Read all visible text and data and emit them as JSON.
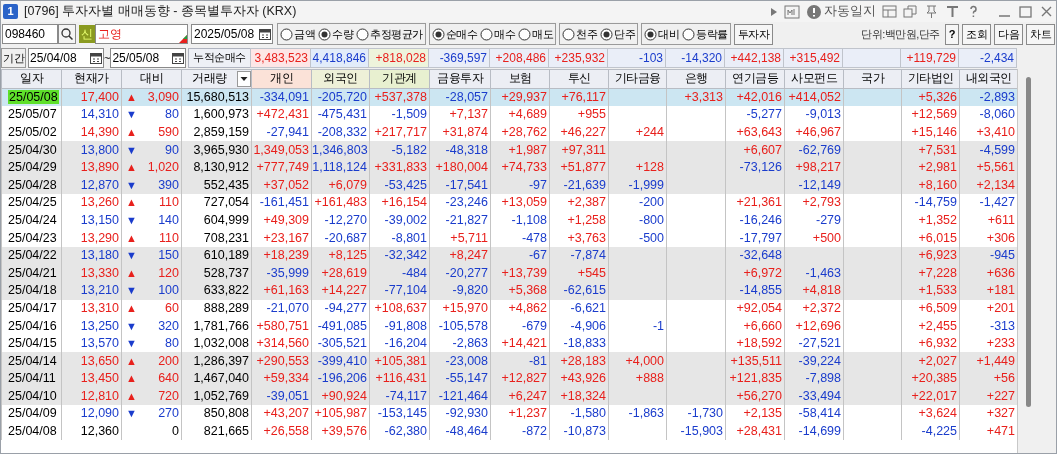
{
  "window": {
    "number": "1",
    "title": "[0796] 투자자별 매매동향 - 종목별투자자 (KRX)",
    "auto_log": "자동일지"
  },
  "toolbar": {
    "code": "098460",
    "new_badge": "신",
    "name": "고영",
    "date": "2025/05/08",
    "option_groups": [
      [
        {
          "label": "금액",
          "selected": false
        },
        {
          "label": "수량",
          "selected": true
        },
        {
          "label": "추정평균가",
          "selected": false
        }
      ],
      [
        {
          "label": "순매수",
          "selected": true
        },
        {
          "label": "매수",
          "selected": false
        },
        {
          "label": "매도",
          "selected": false
        }
      ],
      [
        {
          "label": "천주",
          "selected": false
        },
        {
          "label": "단주",
          "selected": true
        }
      ],
      [
        {
          "label": "대비",
          "selected": true
        },
        {
          "label": "등락률",
          "selected": false
        }
      ]
    ],
    "investor_button": "투자자",
    "unit": "단위:백만원,단주",
    "buttons": [
      "?",
      "조회",
      "다음",
      "차트"
    ]
  },
  "period": {
    "label": "기간",
    "start": "25/04/08",
    "separator": "~",
    "end": "25/05/08",
    "total_label": "누적순매수",
    "totals": {
      "individual": {
        "value": "3,483,523",
        "up": true
      },
      "foreign": {
        "value": "4,418,846",
        "up": false
      },
      "institutions": {
        "value": "+818,028",
        "up": true
      },
      "financial_investment": {
        "value": "-369,597",
        "up": false
      },
      "insurance": {
        "value": "+208,486",
        "up": true
      },
      "investment_trust": {
        "value": "+235,932",
        "up": true
      },
      "other_finance": {
        "value": "-103",
        "up": false
      },
      "bank": {
        "value": "-14,320",
        "up": false
      },
      "pension_funds": {
        "value": "+442,138",
        "up": true
      },
      "private_equity": {
        "value": "+315,492",
        "up": true
      },
      "other_corporations": {
        "value": "+119,729",
        "up": true
      },
      "domestic_foreign": {
        "value": "-2,434",
        "up": false
      }
    }
  },
  "table": {
    "columns": [
      "일자",
      "현재가",
      "대비",
      "거래량",
      "개인",
      "외국인",
      "기관계",
      "금융투자",
      "보험",
      "투신",
      "기타금융",
      "은행",
      "연기금등",
      "사모펀드",
      "국가",
      "기타법인",
      "내외국인"
    ],
    "rows": [
      {
        "date": "25/05/08",
        "selected": true,
        "price": "17,400",
        "rising": true,
        "arrow": "▲",
        "change": "3,090",
        "volume": "15,680,513",
        "investors": {
          "individual": {
            "value": "-334,091",
            "up": false
          },
          "foreign": {
            "value": "-205,720",
            "up": false
          },
          "institutions": {
            "value": "+537,378",
            "up": true
          },
          "financial_investment": {
            "value": "-28,057",
            "up": false
          },
          "insurance": {
            "value": "+29,937",
            "up": true
          },
          "investment_trust": {
            "value": "+76,117",
            "up": true
          },
          "bank": {
            "value": "+3,313",
            "up": true
          },
          "pension_funds": {
            "value": "+42,016",
            "up": true
          },
          "private_equity": {
            "value": "+414,052",
            "up": true
          },
          "other_corporations": {
            "value": "+5,326",
            "up": true
          },
          "domestic_foreign": {
            "value": "-2,893",
            "up": false
          }
        }
      },
      {
        "date": "25/05/07",
        "selected": false,
        "price": "14,310",
        "rising": false,
        "arrow": "▼",
        "change": "80",
        "volume": "1,600,973",
        "investors": {
          "individual": {
            "value": "+472,431",
            "up": true
          },
          "foreign": {
            "value": "-475,431",
            "up": false
          },
          "institutions": {
            "value": "-1,509",
            "up": false
          },
          "financial_investment": {
            "value": "+7,137",
            "up": true
          },
          "insurance": {
            "value": "+4,689",
            "up": true
          },
          "investment_trust": {
            "value": "+955",
            "up": true
          },
          "pension_funds": {
            "value": "-5,277",
            "up": false
          },
          "private_equity": {
            "value": "-9,013",
            "up": false
          },
          "other_corporations": {
            "value": "+12,569",
            "up": true
          },
          "domestic_foreign": {
            "value": "-8,060",
            "up": false
          }
        }
      },
      {
        "date": "25/05/02",
        "selected": false,
        "price": "14,390",
        "rising": true,
        "arrow": "▲",
        "change": "590",
        "volume": "2,859,159",
        "investors": {
          "individual": {
            "value": "-27,941",
            "up": false
          },
          "foreign": {
            "value": "-208,332",
            "up": false
          },
          "institutions": {
            "value": "+217,717",
            "up": true
          },
          "financial_investment": {
            "value": "+31,874",
            "up": true
          },
          "insurance": {
            "value": "+28,762",
            "up": true
          },
          "investment_trust": {
            "value": "+46,227",
            "up": true
          },
          "other_finance": {
            "value": "+244",
            "up": true
          },
          "pension_funds": {
            "value": "+63,643",
            "up": true
          },
          "private_equity": {
            "value": "+46,967",
            "up": true
          },
          "other_corporations": {
            "value": "+15,146",
            "up": true
          },
          "domestic_foreign": {
            "value": "+3,410",
            "up": true
          }
        }
      },
      {
        "date": "25/04/30",
        "selected": false,
        "price": "13,800",
        "rising": false,
        "arrow": "▼",
        "change": "90",
        "volume": "3,965,930",
        "investors": {
          "individual": {
            "value": "1,349,053",
            "up": true
          },
          "foreign": {
            "value": "1,346,803",
            "up": false
          },
          "institutions": {
            "value": "-5,182",
            "up": false
          },
          "financial_investment": {
            "value": "-48,318",
            "up": false
          },
          "insurance": {
            "value": "+1,987",
            "up": true
          },
          "investment_trust": {
            "value": "+97,311",
            "up": true
          },
          "pension_funds": {
            "value": "+6,607",
            "up": true
          },
          "private_equity": {
            "value": "-62,769",
            "up": false
          },
          "other_corporations": {
            "value": "+7,531",
            "up": true
          },
          "domestic_foreign": {
            "value": "-4,599",
            "up": false
          }
        }
      },
      {
        "date": "25/04/29",
        "selected": false,
        "price": "13,890",
        "rising": true,
        "arrow": "▲",
        "change": "1,020",
        "volume": "8,130,912",
        "investors": {
          "individual": {
            "value": "+777,749",
            "up": true
          },
          "foreign": {
            "value": "1,118,124",
            "up": false
          },
          "institutions": {
            "value": "+331,833",
            "up": true
          },
          "financial_investment": {
            "value": "+180,004",
            "up": true
          },
          "insurance": {
            "value": "+74,733",
            "up": true
          },
          "investment_trust": {
            "value": "+51,877",
            "up": true
          },
          "other_finance": {
            "value": "+128",
            "up": true
          },
          "pension_funds": {
            "value": "-73,126",
            "up": false
          },
          "private_equity": {
            "value": "+98,217",
            "up": true
          },
          "other_corporations": {
            "value": "+2,981",
            "up": true
          },
          "domestic_foreign": {
            "value": "+5,561",
            "up": true
          }
        }
      },
      {
        "date": "25/04/28",
        "selected": false,
        "price": "12,870",
        "rising": false,
        "arrow": "▼",
        "change": "390",
        "volume": "552,435",
        "investors": {
          "individual": {
            "value": "+37,052",
            "up": true
          },
          "foreign": {
            "value": "+6,079",
            "up": true
          },
          "institutions": {
            "value": "-53,425",
            "up": false
          },
          "financial_investment": {
            "value": "-17,541",
            "up": false
          },
          "insurance": {
            "value": "-97",
            "up": false
          },
          "investment_trust": {
            "value": "-21,639",
            "up": false
          },
          "other_finance": {
            "value": "-1,999",
            "up": false
          },
          "private_equity": {
            "value": "-12,149",
            "up": false
          },
          "other_corporations": {
            "value": "+8,160",
            "up": true
          },
          "domestic_foreign": {
            "value": "+2,134",
            "up": true
          }
        }
      },
      {
        "date": "25/04/25",
        "selected": false,
        "price": "13,260",
        "rising": true,
        "arrow": "▲",
        "change": "110",
        "volume": "727,054",
        "investors": {
          "individual": {
            "value": "-161,451",
            "up": false
          },
          "foreign": {
            "value": "+161,483",
            "up": true
          },
          "institutions": {
            "value": "+16,154",
            "up": true
          },
          "financial_investment": {
            "value": "-23,246",
            "up": false
          },
          "insurance": {
            "value": "+13,059",
            "up": true
          },
          "investment_trust": {
            "value": "+2,387",
            "up": true
          },
          "other_finance": {
            "value": "-200",
            "up": false
          },
          "pension_funds": {
            "value": "+21,361",
            "up": true
          },
          "private_equity": {
            "value": "+2,793",
            "up": true
          },
          "other_corporations": {
            "value": "-14,759",
            "up": false
          },
          "domestic_foreign": {
            "value": "-1,427",
            "up": false
          }
        }
      },
      {
        "date": "25/04/24",
        "selected": false,
        "price": "13,150",
        "rising": false,
        "arrow": "▼",
        "change": "140",
        "volume": "604,999",
        "investors": {
          "individual": {
            "value": "+49,309",
            "up": true
          },
          "foreign": {
            "value": "-12,270",
            "up": false
          },
          "institutions": {
            "value": "-39,002",
            "up": false
          },
          "financial_investment": {
            "value": "-21,827",
            "up": false
          },
          "insurance": {
            "value": "-1,108",
            "up": false
          },
          "investment_trust": {
            "value": "+1,258",
            "up": true
          },
          "other_finance": {
            "value": "-800",
            "up": false
          },
          "pension_funds": {
            "value": "-16,246",
            "up": false
          },
          "private_equity": {
            "value": "-279",
            "up": false
          },
          "other_corporations": {
            "value": "+1,352",
            "up": true
          },
          "domestic_foreign": {
            "value": "+611",
            "up": true
          }
        }
      },
      {
        "date": "25/04/23",
        "selected": false,
        "price": "13,290",
        "rising": true,
        "arrow": "▲",
        "change": "110",
        "volume": "708,231",
        "investors": {
          "individual": {
            "value": "+23,167",
            "up": true
          },
          "foreign": {
            "value": "-20,687",
            "up": false
          },
          "institutions": {
            "value": "-8,801",
            "up": false
          },
          "financial_investment": {
            "value": "+5,711",
            "up": true
          },
          "insurance": {
            "value": "-478",
            "up": false
          },
          "investment_trust": {
            "value": "+3,763",
            "up": true
          },
          "other_finance": {
            "value": "-500",
            "up": false
          },
          "pension_funds": {
            "value": "-17,797",
            "up": false
          },
          "private_equity": {
            "value": "+500",
            "up": true
          },
          "other_corporations": {
            "value": "+6,015",
            "up": true
          },
          "domestic_foreign": {
            "value": "+306",
            "up": true
          }
        }
      },
      {
        "date": "25/04/22",
        "selected": false,
        "price": "13,180",
        "rising": false,
        "arrow": "▼",
        "change": "150",
        "volume": "610,189",
        "investors": {
          "individual": {
            "value": "+18,239",
            "up": true
          },
          "foreign": {
            "value": "+8,125",
            "up": true
          },
          "institutions": {
            "value": "-32,342",
            "up": false
          },
          "financial_investment": {
            "value": "+8,247",
            "up": true
          },
          "insurance": {
            "value": "-67",
            "up": false
          },
          "investment_trust": {
            "value": "-7,874",
            "up": false
          },
          "pension_funds": {
            "value": "-32,648",
            "up": false
          },
          "other_corporations": {
            "value": "+6,923",
            "up": true
          },
          "domestic_foreign": {
            "value": "-945",
            "up": false
          }
        }
      },
      {
        "date": "25/04/21",
        "selected": false,
        "price": "13,330",
        "rising": true,
        "arrow": "▲",
        "change": "120",
        "volume": "528,737",
        "investors": {
          "individual": {
            "value": "-35,999",
            "up": false
          },
          "foreign": {
            "value": "+28,619",
            "up": true
          },
          "institutions": {
            "value": "-484",
            "up": false
          },
          "financial_investment": {
            "value": "-20,277",
            "up": false
          },
          "insurance": {
            "value": "+13,739",
            "up": true
          },
          "investment_trust": {
            "value": "+545",
            "up": true
          },
          "pension_funds": {
            "value": "+6,972",
            "up": true
          },
          "private_equity": {
            "value": "-1,463",
            "up": false
          },
          "other_corporations": {
            "value": "+7,228",
            "up": true
          },
          "domestic_foreign": {
            "value": "+636",
            "up": true
          }
        }
      },
      {
        "date": "25/04/18",
        "selected": false,
        "price": "13,210",
        "rising": false,
        "arrow": "▼",
        "change": "100",
        "volume": "633,822",
        "investors": {
          "individual": {
            "value": "+61,163",
            "up": true
          },
          "foreign": {
            "value": "+14,227",
            "up": true
          },
          "institutions": {
            "value": "-77,104",
            "up": false
          },
          "financial_investment": {
            "value": "-9,820",
            "up": false
          },
          "insurance": {
            "value": "+5,368",
            "up": true
          },
          "investment_trust": {
            "value": "-62,615",
            "up": false
          },
          "pension_funds": {
            "value": "-14,855",
            "up": false
          },
          "private_equity": {
            "value": "+4,818",
            "up": true
          },
          "other_corporations": {
            "value": "+1,533",
            "up": true
          },
          "domestic_foreign": {
            "value": "+181",
            "up": true
          }
        }
      },
      {
        "date": "25/04/17",
        "selected": false,
        "price": "13,310",
        "rising": true,
        "arrow": "▲",
        "change": "60",
        "volume": "888,289",
        "investors": {
          "individual": {
            "value": "-21,070",
            "up": false
          },
          "foreign": {
            "value": "-94,277",
            "up": false
          },
          "institutions": {
            "value": "+108,637",
            "up": true
          },
          "financial_investment": {
            "value": "+15,970",
            "up": true
          },
          "insurance": {
            "value": "+4,862",
            "up": true
          },
          "investment_trust": {
            "value": "-6,621",
            "up": false
          },
          "pension_funds": {
            "value": "+92,054",
            "up": true
          },
          "private_equity": {
            "value": "+2,372",
            "up": true
          },
          "other_corporations": {
            "value": "+6,509",
            "up": true
          },
          "domestic_foreign": {
            "value": "+201",
            "up": true
          }
        }
      },
      {
        "date": "25/04/16",
        "selected": false,
        "price": "13,250",
        "rising": false,
        "arrow": "▼",
        "change": "320",
        "volume": "1,781,766",
        "investors": {
          "individual": {
            "value": "+580,751",
            "up": true
          },
          "foreign": {
            "value": "-491,085",
            "up": false
          },
          "institutions": {
            "value": "-91,808",
            "up": false
          },
          "financial_investment": {
            "value": "-105,578",
            "up": false
          },
          "insurance": {
            "value": "-679",
            "up": false
          },
          "investment_trust": {
            "value": "-4,906",
            "up": false
          },
          "other_finance": {
            "value": "-1",
            "up": false
          },
          "pension_funds": {
            "value": "+6,660",
            "up": true
          },
          "private_equity": {
            "value": "+12,696",
            "up": true
          },
          "other_corporations": {
            "value": "+2,455",
            "up": true
          },
          "domestic_foreign": {
            "value": "-313",
            "up": false
          }
        }
      },
      {
        "date": "25/04/15",
        "selected": false,
        "price": "13,570",
        "rising": false,
        "arrow": "▼",
        "change": "80",
        "volume": "1,032,008",
        "investors": {
          "individual": {
            "value": "+314,560",
            "up": true
          },
          "foreign": {
            "value": "-305,521",
            "up": false
          },
          "institutions": {
            "value": "-16,204",
            "up": false
          },
          "financial_investment": {
            "value": "-2,863",
            "up": false
          },
          "insurance": {
            "value": "+14,421",
            "up": true
          },
          "investment_trust": {
            "value": "-18,833",
            "up": false
          },
          "pension_funds": {
            "value": "+18,592",
            "up": true
          },
          "private_equity": {
            "value": "-27,521",
            "up": false
          },
          "other_corporations": {
            "value": "+6,932",
            "up": true
          },
          "domestic_foreign": {
            "value": "+233",
            "up": true
          }
        }
      },
      {
        "date": "25/04/14",
        "selected": false,
        "price": "13,650",
        "rising": true,
        "arrow": "▲",
        "change": "200",
        "volume": "1,286,397",
        "investors": {
          "individual": {
            "value": "+290,553",
            "up": true
          },
          "foreign": {
            "value": "-399,410",
            "up": false
          },
          "institutions": {
            "value": "+105,381",
            "up": true
          },
          "financial_investment": {
            "value": "-23,008",
            "up": false
          },
          "insurance": {
            "value": "-81",
            "up": false
          },
          "investment_trust": {
            "value": "+28,183",
            "up": true
          },
          "other_finance": {
            "value": "+4,000",
            "up": true
          },
          "pension_funds": {
            "value": "+135,511",
            "up": true
          },
          "private_equity": {
            "value": "-39,224",
            "up": false
          },
          "other_corporations": {
            "value": "+2,027",
            "up": true
          },
          "domestic_foreign": {
            "value": "+1,449",
            "up": true
          }
        }
      },
      {
        "date": "25/04/11",
        "selected": false,
        "price": "13,450",
        "rising": true,
        "arrow": "▲",
        "change": "640",
        "volume": "1,467,040",
        "investors": {
          "individual": {
            "value": "+59,334",
            "up": true
          },
          "foreign": {
            "value": "-196,206",
            "up": false
          },
          "institutions": {
            "value": "+116,431",
            "up": true
          },
          "financial_investment": {
            "value": "-55,147",
            "up": false
          },
          "insurance": {
            "value": "+12,827",
            "up": true
          },
          "investment_trust": {
            "value": "+43,926",
            "up": true
          },
          "other_finance": {
            "value": "+888",
            "up": true
          },
          "pension_funds": {
            "value": "+121,835",
            "up": true
          },
          "private_equity": {
            "value": "-7,898",
            "up": false
          },
          "other_corporations": {
            "value": "+20,385",
            "up": true
          },
          "domestic_foreign": {
            "value": "+56",
            "up": true
          }
        }
      },
      {
        "date": "25/04/10",
        "selected": false,
        "price": "12,810",
        "rising": true,
        "arrow": "▲",
        "change": "720",
        "volume": "1,052,769",
        "investors": {
          "individual": {
            "value": "-39,051",
            "up": false
          },
          "foreign": {
            "value": "+90,924",
            "up": true
          },
          "institutions": {
            "value": "-74,117",
            "up": false
          },
          "financial_investment": {
            "value": "-121,464",
            "up": false
          },
          "insurance": {
            "value": "+6,247",
            "up": true
          },
          "investment_trust": {
            "value": "+18,324",
            "up": true
          },
          "pension_funds": {
            "value": "+56,270",
            "up": true
          },
          "private_equity": {
            "value": "-33,494",
            "up": false
          },
          "other_corporations": {
            "value": "+22,017",
            "up": true
          },
          "domestic_foreign": {
            "value": "+227",
            "up": true
          }
        }
      },
      {
        "date": "25/04/09",
        "selected": false,
        "price": "12,090",
        "rising": false,
        "arrow": "▼",
        "change": "270",
        "volume": "850,808",
        "investors": {
          "individual": {
            "value": "+43,207",
            "up": true
          },
          "foreign": {
            "value": "+105,987",
            "up": true
          },
          "institutions": {
            "value": "-153,145",
            "up": false
          },
          "financial_investment": {
            "value": "-92,930",
            "up": false
          },
          "insurance": {
            "value": "+1,237",
            "up": true
          },
          "investment_trust": {
            "value": "-1,580",
            "up": false
          },
          "other_finance": {
            "value": "-1,863",
            "up": false
          },
          "bank": {
            "value": "-1,730",
            "up": false
          },
          "pension_funds": {
            "value": "+2,135",
            "up": true
          },
          "private_equity": {
            "value": "-58,414",
            "up": false
          },
          "other_corporations": {
            "value": "+3,624",
            "up": true
          },
          "domestic_foreign": {
            "value": "+327",
            "up": true
          }
        }
      },
      {
        "date": "25/04/08",
        "selected": false,
        "price": "12,360",
        "change": "0",
        "volume": "821,665",
        "investors": {
          "individual": {
            "value": "+26,558",
            "up": true
          },
          "foreign": {
            "value": "+39,576",
            "up": true
          },
          "institutions": {
            "value": "-62,380",
            "up": false
          },
          "financial_investment": {
            "value": "-48,464",
            "up": false
          },
          "insurance": {
            "value": "-872",
            "up": false
          },
          "investment_trust": {
            "value": "-10,873",
            "up": false
          },
          "bank": {
            "value": "-15,903",
            "up": false
          },
          "pension_funds": {
            "value": "+28,431",
            "up": true
          },
          "private_equity": {
            "value": "-14,699",
            "up": false
          },
          "other_corporations": {
            "value": "-4,225",
            "up": false
          },
          "domestic_foreign": {
            "value": "+471",
            "up": true
          }
        }
      }
    ]
  }
}
